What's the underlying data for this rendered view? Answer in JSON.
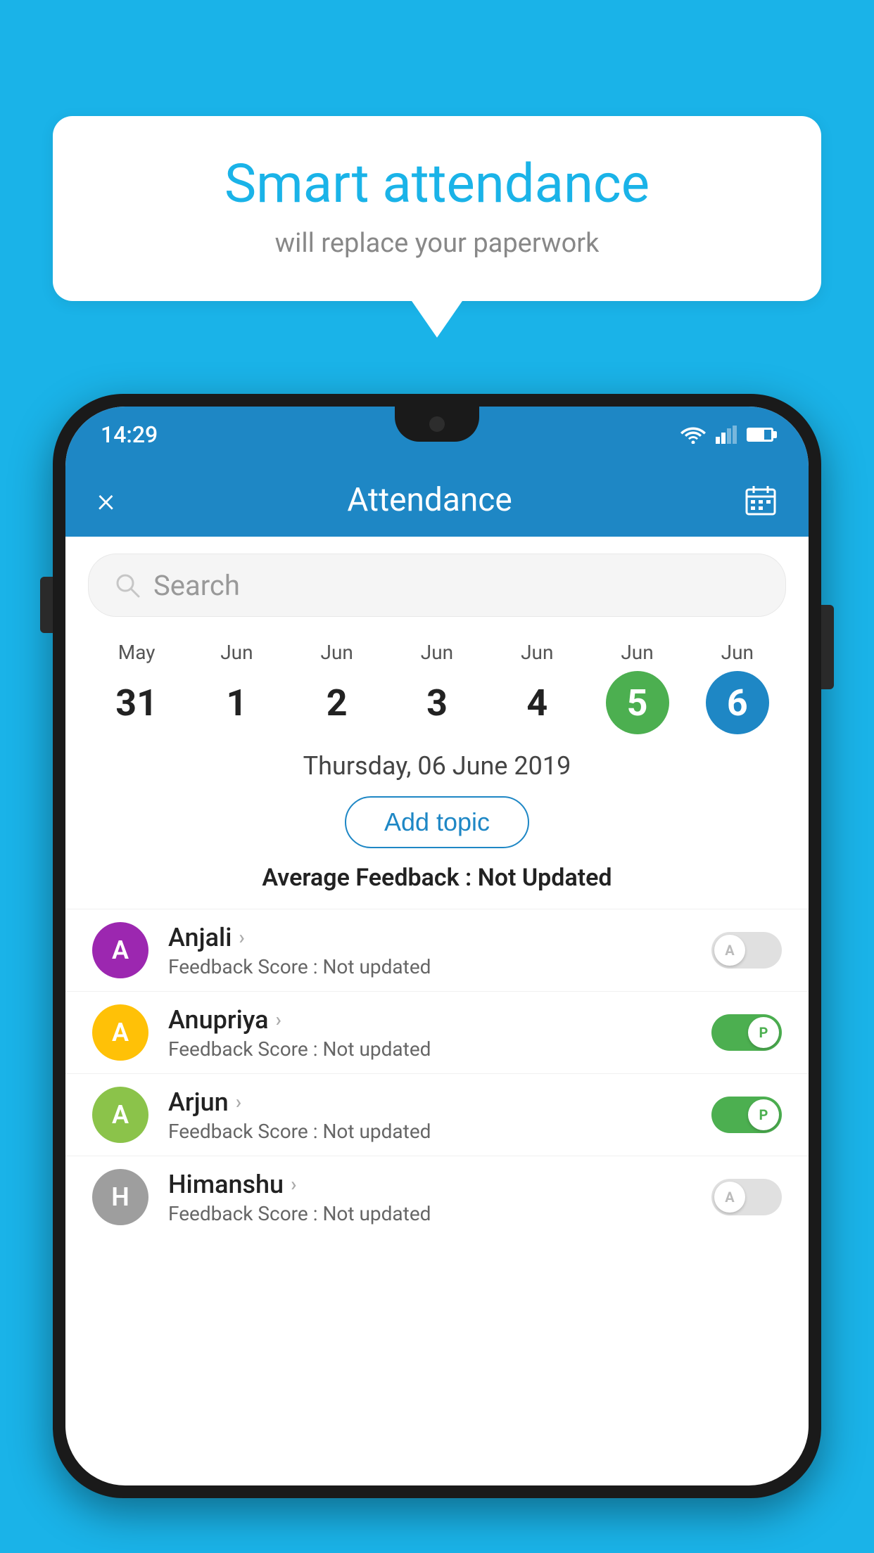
{
  "background_color": "#1ab3e8",
  "bubble": {
    "title": "Smart attendance",
    "subtitle": "will replace your paperwork"
  },
  "phone": {
    "status_bar": {
      "time": "14:29",
      "wifi": "wifi",
      "signal": "signal",
      "battery": "battery"
    },
    "header": {
      "close_icon": "×",
      "title": "Attendance",
      "calendar_icon": "calendar"
    },
    "search": {
      "placeholder": "Search"
    },
    "calendar": {
      "days": [
        {
          "month": "May",
          "date": "31",
          "style": "normal"
        },
        {
          "month": "Jun",
          "date": "1",
          "style": "normal"
        },
        {
          "month": "Jun",
          "date": "2",
          "style": "normal"
        },
        {
          "month": "Jun",
          "date": "3",
          "style": "normal"
        },
        {
          "month": "Jun",
          "date": "4",
          "style": "normal"
        },
        {
          "month": "Jun",
          "date": "5",
          "style": "today"
        },
        {
          "month": "Jun",
          "date": "6",
          "style": "selected"
        }
      ]
    },
    "selected_date": "Thursday, 06 June 2019",
    "add_topic_label": "Add topic",
    "avg_feedback_label": "Average Feedback :",
    "avg_feedback_value": "Not Updated",
    "students": [
      {
        "name": "Anjali",
        "avatar_letter": "A",
        "avatar_color": "#9c27b0",
        "score_label": "Feedback Score :",
        "score_value": "Not updated",
        "attendance": "absent",
        "toggle_label": "A"
      },
      {
        "name": "Anupriya",
        "avatar_letter": "A",
        "avatar_color": "#ffc107",
        "score_label": "Feedback Score :",
        "score_value": "Not updated",
        "attendance": "present",
        "toggle_label": "P"
      },
      {
        "name": "Arjun",
        "avatar_letter": "A",
        "avatar_color": "#8bc34a",
        "score_label": "Feedback Score :",
        "score_value": "Not updated",
        "attendance": "present",
        "toggle_label": "P"
      },
      {
        "name": "Himanshu",
        "avatar_letter": "H",
        "avatar_color": "#9e9e9e",
        "score_label": "Feedback Score :",
        "score_value": "Not updated",
        "attendance": "absent",
        "toggle_label": "A"
      }
    ]
  }
}
